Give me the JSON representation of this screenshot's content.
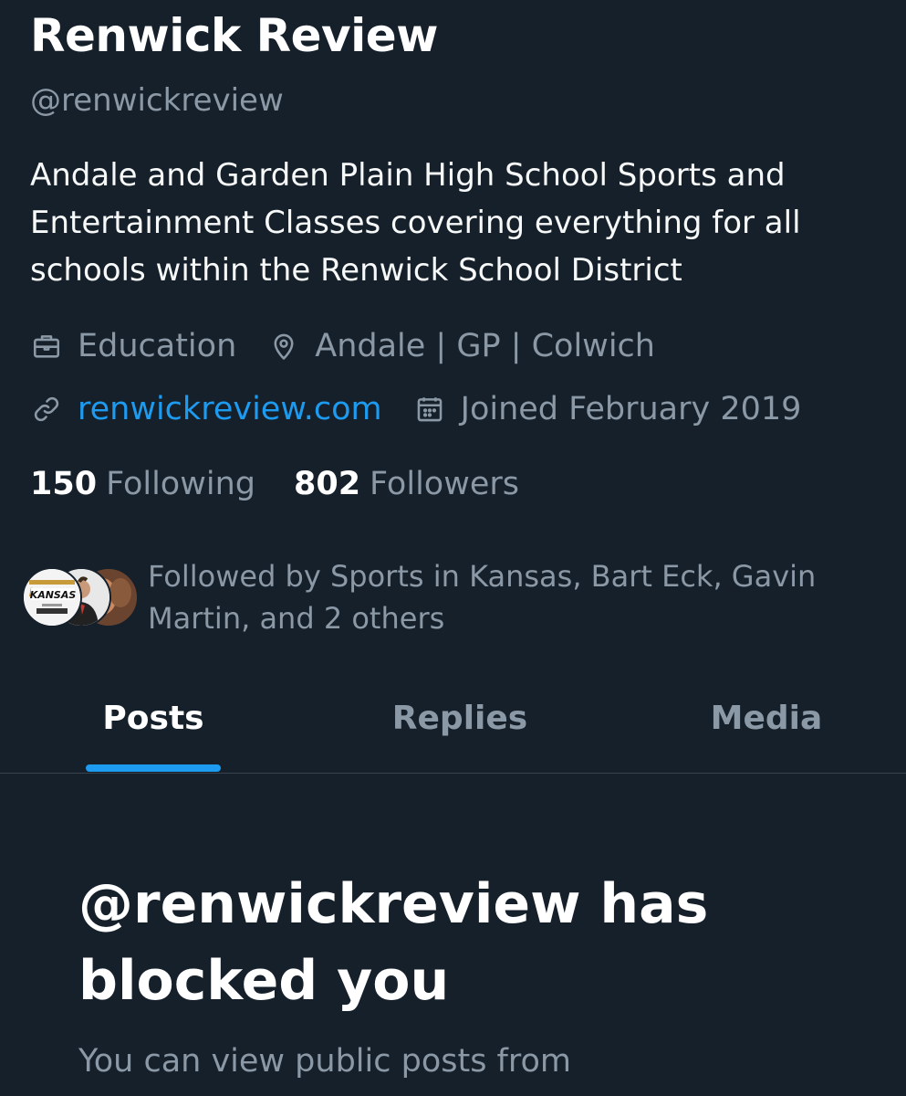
{
  "profile": {
    "display_name": "Renwick Review",
    "handle": "@renwickreview",
    "bio": "Andale and Garden Plain High School Sports and Entertainment Classes covering everything for all schools within the Renwick School District",
    "category": "Education",
    "location": "Andale | GP |  Colwich",
    "website": "renwickreview.com",
    "joined": "Joined February 2019",
    "following_count": "150",
    "following_label": "Following",
    "followers_count": "802",
    "followers_label": "Followers",
    "followed_by": "Followed by Sports in Kansas, Bart Eck, Gavin Martin, and 2 others",
    "followed_by_avatars": [
      {
        "avatar_text": "KANSAS"
      },
      {
        "avatar_text": ""
      },
      {
        "avatar_text": ""
      }
    ]
  },
  "tabs": [
    {
      "label": "Posts",
      "active": true
    },
    {
      "label": "Replies",
      "active": false
    },
    {
      "label": "Media",
      "active": false
    }
  ],
  "blocked": {
    "title": "@renwickreview has blocked you",
    "description": "You can view public posts from"
  },
  "colors": {
    "background": "#15202b",
    "accent": "#1d9bf0",
    "secondary_text": "#8b98a5",
    "primary_text": "#ffffff"
  },
  "icons": {
    "category": "briefcase-icon",
    "location": "location-pin-icon",
    "website": "link-icon",
    "joined": "calendar-icon"
  }
}
